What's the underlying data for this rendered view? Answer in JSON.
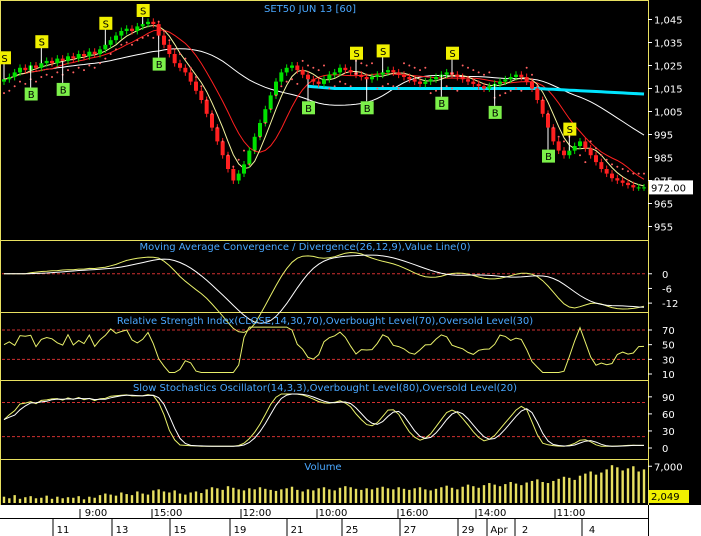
{
  "chart_data": [
    {
      "type": "line",
      "panel": "price",
      "title": "SET50 JUN 13   [60]",
      "yticks": [
        955,
        965,
        975,
        985,
        995,
        1005,
        1015,
        1025,
        1035,
        1045
      ],
      "yticks_labeled": [
        "955",
        "965",
        "975",
        "985",
        "995",
        "1,005",
        "1,015",
        "1,025",
        "1,035",
        "1,045"
      ],
      "ylim": [
        950,
        1050
      ],
      "last_price": "972.00",
      "x": [
        0,
        2,
        4,
        6,
        8,
        10,
        12,
        14,
        16,
        18,
        20,
        22,
        24,
        26,
        28,
        30,
        32,
        34,
        36,
        38,
        40,
        42,
        44,
        46,
        48,
        50,
        52,
        54,
        56,
        58,
        60,
        62,
        64,
        66,
        68,
        70,
        72,
        74,
        76,
        78,
        80,
        82,
        84,
        86,
        88,
        90,
        92,
        94,
        96,
        98,
        100,
        102,
        104,
        106,
        108,
        110,
        112,
        114,
        116,
        118,
        120,
        122,
        124,
        126,
        128,
        130,
        132,
        134,
        136,
        138,
        140,
        142,
        144,
        146,
        148,
        150,
        152,
        154,
        156,
        158,
        160,
        162,
        164,
        166,
        168,
        170,
        172,
        174,
        176,
        178,
        180,
        182,
        184,
        186,
        188,
        190,
        192,
        194,
        196,
        198,
        200,
        202,
        204,
        206,
        208,
        210,
        212,
        214,
        216,
        218,
        220,
        222,
        224,
        226,
        228,
        230,
        232,
        234,
        236,
        238,
        240
      ],
      "series": [
        {
          "name": "Close",
          "values": [
            1019,
            1020,
            1022,
            1024,
            1023,
            1025,
            1024,
            1026,
            1027,
            1026,
            1028,
            1027,
            1029,
            1028,
            1030,
            1029,
            1031,
            1030,
            1032,
            1034,
            1036,
            1038,
            1040,
            1041,
            1040,
            1042,
            1043,
            1044,
            1043,
            1038,
            1034,
            1030,
            1026,
            1024,
            1022,
            1018,
            1014,
            1010,
            1004,
            998,
            992,
            986,
            980,
            975,
            978,
            982,
            988,
            994,
            1000,
            1006,
            1012,
            1018,
            1022,
            1024,
            1025,
            1023,
            1021,
            1019,
            1018,
            1017,
            1019,
            1021,
            1022,
            1024,
            1023,
            1022,
            1021,
            1020,
            1019,
            1020,
            1021,
            1022,
            1023,
            1022,
            1021,
            1020,
            1019,
            1018,
            1017,
            1018,
            1019,
            1020,
            1021,
            1022,
            1021,
            1020,
            1019,
            1018,
            1017,
            1016,
            1015,
            1016,
            1017,
            1018,
            1019,
            1020,
            1021,
            1020,
            1018,
            1015,
            1010,
            1004,
            998,
            992,
            988,
            986,
            988,
            990,
            992,
            989,
            986,
            983,
            980,
            978,
            976,
            975,
            974,
            973,
            972,
            972,
            972
          ]
        },
        {
          "name": "Volume",
          "values": [
            1200,
            900,
            1500,
            800,
            1100,
            1300,
            900,
            1000,
            1400,
            800,
            1200,
            900,
            1100,
            1000,
            1300,
            700,
            1200,
            1000,
            1500,
            1800,
            1600,
            1400,
            2000,
            1700,
            1500,
            2200,
            1800,
            1600,
            2400,
            2600,
            2200,
            2000,
            2400,
            1800,
            1600,
            2000,
            2200,
            1900,
            2600,
            3000,
            2800,
            2500,
            3200,
            2900,
            2600,
            2400,
            2800,
            2600,
            3000,
            2700,
            2500,
            2300,
            2600,
            2800,
            3100,
            2500,
            2200,
            2600,
            2400,
            2800,
            3000,
            2600,
            2400,
            2900,
            3200,
            3000,
            2700,
            2500,
            2800,
            2600,
            2900,
            3100,
            2800,
            2600,
            3000,
            2700,
            2500,
            2800,
            3000,
            2600,
            2400,
            2700,
            3000,
            3300,
            2900,
            2600,
            3100,
            3500,
            3200,
            2900,
            3400,
            3800,
            3500,
            3200,
            3600,
            4000,
            3700,
            3400,
            3900,
            4200,
            4500,
            4000,
            3800,
            4200,
            4600,
            5000,
            4800,
            4400,
            5200,
            5600,
            6000,
            5400,
            5800,
            6400,
            7200,
            6800,
            6200,
            6600,
            7000,
            6000,
            6400
          ]
        }
      ]
    },
    {
      "type": "line",
      "panel": "macd",
      "title": "Moving Average Convergence / Divergence(26,12,9),Value Line(0)",
      "yticks": [
        "0",
        "-6",
        "-12"
      ]
    },
    {
      "type": "line",
      "panel": "rsi",
      "title": "Relative Strength Index(CLOSE,14,30,70),Overbought Level(70),Oversold Level(30)",
      "yticks": [
        "70",
        "50",
        "30",
        "10"
      ]
    },
    {
      "type": "line",
      "panel": "stoch",
      "title": "Slow Stochastics Oscillator(14,3,3),Overbought Level(80),Oversold Level(20)",
      "yticks": [
        "90",
        "60",
        "30",
        "0"
      ]
    },
    {
      "type": "bar",
      "panel": "volume",
      "title": "Volume",
      "yticks": [
        "7,000"
      ],
      "last_volume": "2,049"
    }
  ],
  "xaxis": {
    "dates": [
      "11",
      "13",
      "15",
      "19",
      "21",
      "25",
      "27",
      "29",
      "Apr",
      "2",
      "4"
    ],
    "times": [
      "9:00",
      "15:00",
      "12:00",
      "10:00",
      "16:00",
      "14:00",
      "11:00"
    ]
  },
  "signals": {
    "sell_label": "S",
    "buy_label": "B"
  },
  "colors": {
    "background": "#000000",
    "grid_border": "#e8e060",
    "title": "#4aa8ff",
    "up_candle": "#00e000",
    "down_candle": "#ff2020",
    "ma_fast": "#ffffff",
    "ma_slow": "#ff2020",
    "ma_long": "#ffffff",
    "cyan_line": "#00e5ff",
    "sar": "#ff6060",
    "macd": "#e8f06a",
    "rsi": "#e8f06a",
    "level_line": "#d03030",
    "volume": "#e8e060",
    "price_tag": "#ffffff",
    "volume_tag": "#f0f000"
  }
}
